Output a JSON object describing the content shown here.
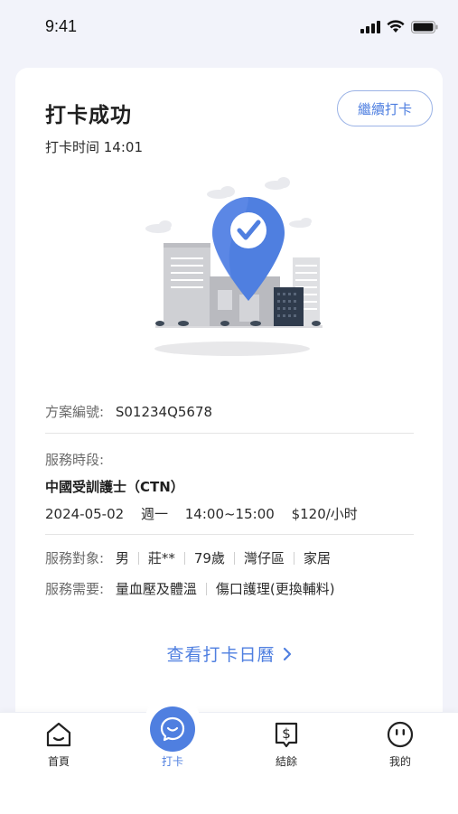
{
  "status": {
    "time": "9:41"
  },
  "card": {
    "title": "打卡成功",
    "checkin_time": "打卡时间 14:01",
    "continue_button": "繼續打卡",
    "plan_label": "方案編號:",
    "plan_number": "S01234Q5678",
    "service_period_label": "服務時段:",
    "service_type": "中國受訓護士（CTN）",
    "service_date": "2024-05-02",
    "service_weekday": "週一",
    "service_hours": "14:00~15:00",
    "service_price": "$120/小时",
    "target_label": "服務對象:",
    "target_tags": [
      "男",
      "莊**",
      "79歲",
      "灣仔區",
      "家居"
    ],
    "needs_label": "服務需要:",
    "needs_tags": [
      "量血壓及體溫",
      "傷口護理(更換輔料)"
    ],
    "calendar_link": "查看打卡日曆"
  },
  "tabs": [
    {
      "label": "首頁",
      "icon": "home-icon"
    },
    {
      "label": "打卡",
      "icon": "checkin-icon"
    },
    {
      "label": "結餘",
      "icon": "balance-icon"
    },
    {
      "label": "我的",
      "icon": "profile-icon"
    }
  ],
  "colors": {
    "accent": "#4f7fe0",
    "background": "#f2f3fa"
  }
}
